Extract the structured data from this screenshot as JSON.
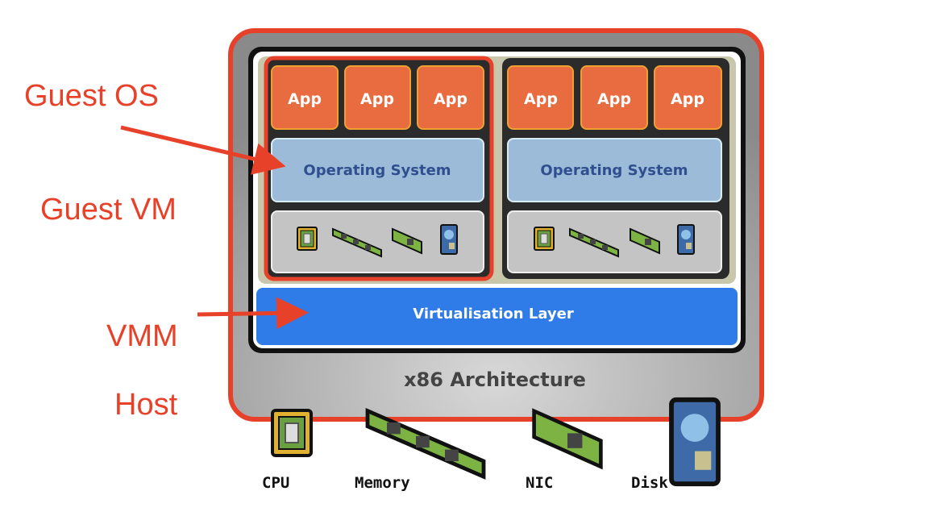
{
  "labels": {
    "guest_os": "Guest OS",
    "guest_vm": "Guest VM",
    "vmm": "VMM",
    "host": "Host"
  },
  "vms": [
    {
      "apps": [
        "App",
        "App",
        "App"
      ],
      "os": "Operating System"
    },
    {
      "apps": [
        "App",
        "App",
        "App"
      ],
      "os": "Operating System"
    }
  ],
  "virtualisation_layer": "Virtualisation Layer",
  "architecture": "x86 Architecture",
  "hardware": [
    "CPU",
    "Memory",
    "NIC",
    "Disk"
  ],
  "colors": {
    "annotation": "#e8412a",
    "app": "#e86c40",
    "os": "#9bbbd8",
    "virtualisation": "#2f7be8"
  }
}
